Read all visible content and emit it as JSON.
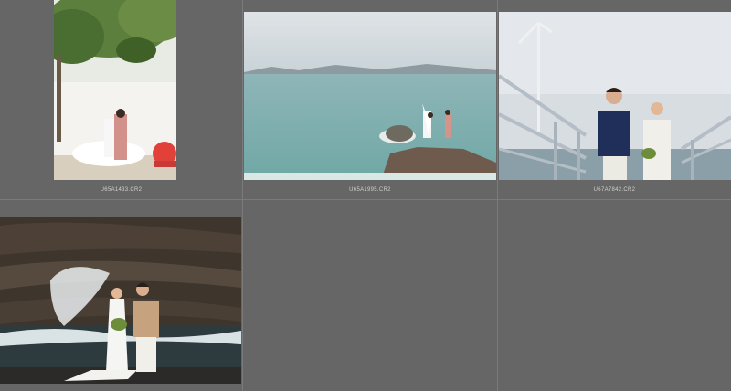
{
  "filmstrip": {
    "items": [
      {
        "filename": "U65A1433.CR2",
        "selected": false
      },
      {
        "filename": "U65A1995.CR2",
        "selected": false
      },
      {
        "filename": "U67A7842.CR2",
        "selected": false
      },
      {
        "filename": "",
        "selected": false
      }
    ]
  },
  "colors": {
    "background": "#666666",
    "cell_divider": "#7a7a7a",
    "filename_text": "#d0d0d0"
  }
}
